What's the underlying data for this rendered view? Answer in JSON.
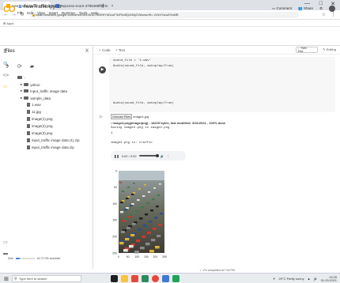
{
  "browser": {
    "tabs": [
      {
        "label": "newTraffic.ipynb - Colaborat",
        "close": "×"
      },
      {
        "label": "Success score-4796469fbg.m",
        "close": "×"
      }
    ],
    "new_tab": "+",
    "window_controls": [
      "—",
      "□"
    ],
    "url": "colab.research.google.com/drive/1c4Vb3c7000HlYhDcuF3vFfa4fQzN3y2VAsxsLtfi=-VZsVXwuZHoMB",
    "bookmarks": "Apps"
  },
  "colab": {
    "logo": "CO",
    "notebook_name": "newTraffic.ipynb",
    "menu": [
      "File",
      "Edit",
      "View",
      "Insert",
      "Runtime",
      "Tools",
      "Help"
    ],
    "comment": "Comment",
    "share": "Share"
  },
  "sidebar": {
    "title": "Files",
    "close": "X",
    "items": [
      {
        "name": "..",
        "type": "folder"
      },
      {
        "name": "yahoo",
        "type": "folder"
      },
      {
        "name": "input_traffic image data",
        "type": "folder"
      },
      {
        "name": "sample_data",
        "type": "folder"
      },
      {
        "name": "1.wav",
        "type": "file"
      },
      {
        "name": "11.jpg",
        "type": "file"
      },
      {
        "name": "image(1).png",
        "type": "file"
      },
      {
        "name": "image(2).png",
        "type": "file"
      },
      {
        "name": "image(3).png",
        "type": "file"
      },
      {
        "name": "input_traffic image data (1).zip",
        "type": "file"
      },
      {
        "name": "input_traffic image data.zip",
        "type": "file"
      }
    ],
    "disk": "Disk",
    "disk_usage": "64.72 GB available",
    "disk_fraction": 0.2
  },
  "toolbar": {
    "code": "+ Code",
    "text": "+ Text",
    "ram": "RAM",
    "disk": "Disk",
    "editing": "Editing"
  },
  "cell": {
    "lines": [
      "sound_file = '1.wav'",
      "Audio(sound_file, autoplay=True)",
      "",
      "Audio(sound_file, autoplay=True)"
    ]
  },
  "output": {
    "choose": "Choose Files",
    "choose_file": "image4.jpg",
    "uploaded": "image4.png(image/png) - 18225 bytes, last modified: 3/31/2021 - 100% done",
    "saving": "Saving image4.png to image4.png",
    "echo": "1",
    "result": "image4.png is: traffic",
    "player_time": "0:02 / 0:02"
  },
  "chart_data": {
    "type": "image",
    "yticks": [
      0,
      50,
      100,
      150,
      200,
      250
    ],
    "xticks": [
      0,
      50,
      100,
      150,
      200,
      250
    ],
    "ylim": [
      0,
      250
    ],
    "xlim": [
      0,
      250
    ]
  },
  "status": {
    "check": "✓",
    "duration": "17s",
    "completed": "completed at 7:24 PM"
  },
  "taskbar": {
    "search": "Type here to search",
    "weather": "29°C  Partly sunny",
    "time": "19:25",
    "date": "31-03-2021"
  }
}
